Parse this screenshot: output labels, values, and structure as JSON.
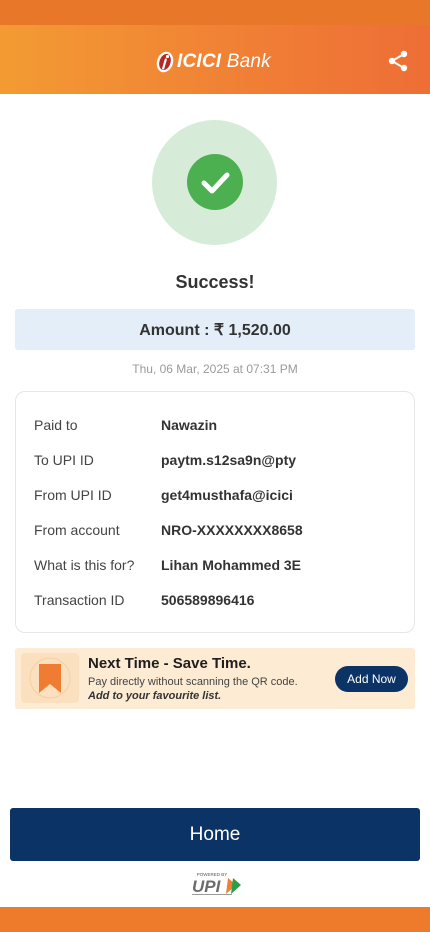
{
  "header": {
    "logo_brand": "ICICI",
    "logo_suffix": "Bank",
    "share_icon": "share-icon"
  },
  "status": {
    "icon": "check-icon",
    "title": "Success!"
  },
  "amount": {
    "text": "Amount : ₹ 1,520.00"
  },
  "timestamp": "Thu, 06 Mar, 2025 at 07:31 PM",
  "details": [
    {
      "label": "Paid to",
      "value": "Nawazin"
    },
    {
      "label": "To UPI ID",
      "value": "paytm.s12sa9n@pty"
    },
    {
      "label": "From UPI ID",
      "value": "get4musthafa@icici"
    },
    {
      "label": "From account",
      "value": "NRO-XXXXXXXX8658"
    },
    {
      "label": "What is this for?",
      "value": "Lihan Mohammed 3E"
    },
    {
      "label": "Transaction ID",
      "value": "506589896416"
    }
  ],
  "banner": {
    "icon": "bookmark-icon",
    "title": "Next Time - Save Time.",
    "subtitle": "Pay directly without scanning the QR code.",
    "subtitle2": "Add to your favourite list.",
    "button_label": "Add Now"
  },
  "footer": {
    "home_label": "Home",
    "upi_powered": "POWERED BY",
    "upi_text": "UPI"
  },
  "colors": {
    "brand_orange": "#f07e35",
    "navy": "#0b3366",
    "success_green": "#4caf50"
  }
}
